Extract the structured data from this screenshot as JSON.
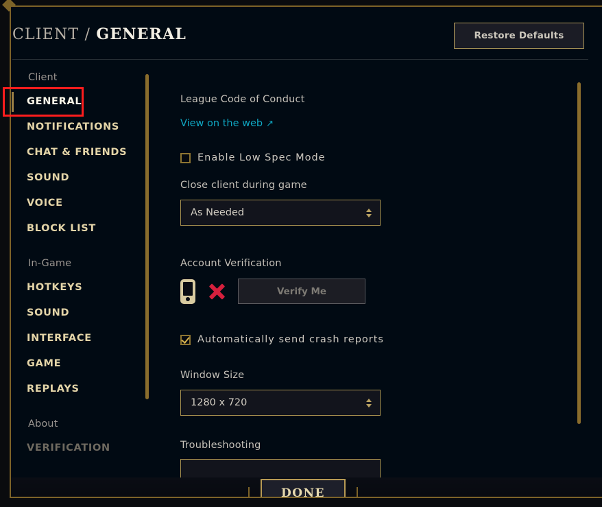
{
  "header": {
    "breadcrumb_primary": "CLIENT",
    "breadcrumb_separator": "/",
    "breadcrumb_current": "GENERAL",
    "restore_defaults_label": "Restore Defaults"
  },
  "sidebar": {
    "groups": [
      {
        "label": "Client",
        "items": [
          {
            "label": "GENERAL",
            "state": "active"
          },
          {
            "label": "NOTIFICATIONS",
            "state": "normal"
          },
          {
            "label": "CHAT & FRIENDS",
            "state": "normal"
          },
          {
            "label": "SOUND",
            "state": "normal"
          },
          {
            "label": "VOICE",
            "state": "normal"
          },
          {
            "label": "BLOCK LIST",
            "state": "normal"
          }
        ]
      },
      {
        "label": "In-Game",
        "items": [
          {
            "label": "HOTKEYS",
            "state": "normal"
          },
          {
            "label": "SOUND",
            "state": "normal"
          },
          {
            "label": "INTERFACE",
            "state": "normal"
          },
          {
            "label": "GAME",
            "state": "normal"
          },
          {
            "label": "REPLAYS",
            "state": "normal"
          }
        ]
      },
      {
        "label": "About",
        "items": [
          {
            "label": "VERIFICATION",
            "state": "dim"
          }
        ]
      }
    ]
  },
  "content": {
    "code_of_conduct_label": "League Code of Conduct",
    "code_of_conduct_link": "View on the web",
    "code_of_conduct_link_arrow": "↗",
    "low_spec_label": "Enable Low Spec Mode",
    "low_spec_checked": false,
    "close_client_label": "Close client during game",
    "close_client_value": "As Needed",
    "account_verification_label": "Account Verification",
    "verify_button_label": "Verify Me",
    "verify_status_icon": "red-x-icon",
    "verify_device_icon": "mobile-phone-icon",
    "crash_reports_label": "Automatically send crash reports",
    "crash_reports_checked": true,
    "window_size_label": "Window Size",
    "window_size_value": "1280 x 720",
    "troubleshooting_label": "Troubleshooting"
  },
  "footer": {
    "done_label": "DONE"
  },
  "annotation": {
    "highlight_color": "#ff1d1d",
    "highlight_target": "GENERAL"
  },
  "colors": {
    "accent_gold": "#b09a5a",
    "link_blue": "#0fa8c4",
    "error_red": "#d6203d",
    "window_bg": "#010a13"
  }
}
